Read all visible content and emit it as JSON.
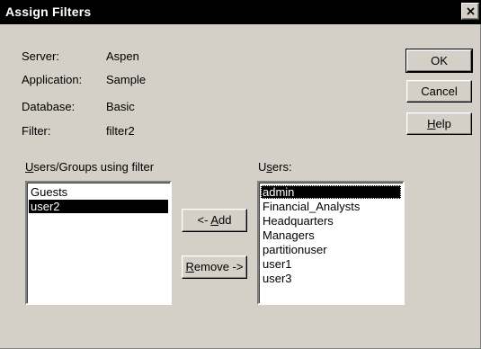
{
  "window": {
    "title": "Assign Filters"
  },
  "info": {
    "server_label": "Server:",
    "server_value": "Aspen",
    "application_label": "Application:",
    "application_value": "Sample",
    "database_label": "Database:",
    "database_value": "Basic",
    "filter_label": "Filter:",
    "filter_value": "filter2"
  },
  "buttons": {
    "ok": "OK",
    "cancel": "Cancel",
    "help_pre": "",
    "help_key": "H",
    "help_post": "elp",
    "add_pre": "<- ",
    "add_key": "A",
    "add_post": "dd",
    "remove_pre": "",
    "remove_key": "R",
    "remove_post": "emove ->"
  },
  "left_list": {
    "label_key": "U",
    "label_rest": "sers/Groups using filter",
    "items": [
      "Guests",
      "user2"
    ],
    "selected": "user2"
  },
  "right_list": {
    "label_pre": "U",
    "label_key": "s",
    "label_post": "ers:",
    "items": [
      "admin",
      "Financial_Analysts",
      "Headquarters",
      "Managers",
      "partitionuser",
      "user1",
      "user3"
    ],
    "selected": "admin"
  }
}
